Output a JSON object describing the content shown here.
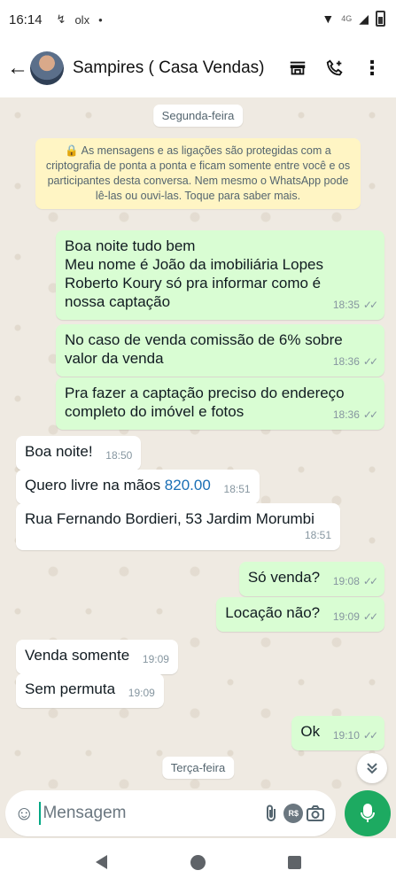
{
  "status_bar": {
    "time": "16:14",
    "network_label": "4G",
    "notification_label": "olx"
  },
  "header": {
    "back_icon": "arrow-left-icon",
    "contact_name": "Sampires ( Casa Vendas)",
    "icons": [
      "storefront-icon",
      "add-call-icon",
      "more-vert-icon"
    ]
  },
  "chat": {
    "date_monday": "Segunda-feira",
    "encryption_notice": "🔒 As mensagens e as ligações são protegidas com a criptografia de ponta a ponta e ficam somente entre você e os participantes desta conversa. Nem mesmo o WhatsApp pode lê-las ou ouvi-las. Toque para saber mais.",
    "messages": [
      {
        "direction": "out",
        "lines": [
          "Boa noite tudo bem",
          "Meu nome é João da imobiliária Lopes",
          "Roberto Koury só pra informar como é",
          "nossa captação"
        ],
        "time": "18:35",
        "ticks": "✓✓"
      },
      {
        "direction": "out",
        "lines": [
          "No caso de venda comissão de 6% sobre",
          "valor da venda"
        ],
        "time": "18:36",
        "ticks": "✓✓"
      },
      {
        "direction": "out",
        "lines": [
          "Pra fazer a captação preciso do endereço",
          "completo do imóvel e fotos"
        ],
        "time": "18:36",
        "ticks": "✓✓"
      },
      {
        "direction": "in",
        "text": "Boa noite!",
        "time": "18:50"
      },
      {
        "direction": "in",
        "text_before": "Quero livre na mãos ",
        "link_number": "820.00",
        "time": "18:51"
      },
      {
        "direction": "in",
        "text": "Rua Fernando Bordieri, 53 Jardim Morumbi",
        "time": "18:51"
      },
      {
        "direction": "out",
        "text": "Só venda?",
        "time": "19:08",
        "ticks": "✓✓"
      },
      {
        "direction": "out",
        "text": "Locação não?",
        "time": "19:09",
        "ticks": "✓✓"
      },
      {
        "direction": "in",
        "text": "Venda somente",
        "time": "19:09"
      },
      {
        "direction": "in",
        "text": "Sem permuta",
        "time": "19:09"
      },
      {
        "direction": "out",
        "text": "Ok",
        "time": "19:10",
        "ticks": "✓✓"
      }
    ],
    "date_tuesday": "Terça-feira",
    "scroll_down_icon": "double-chevron-down-icon"
  },
  "input_bar": {
    "placeholder": "Mensagem",
    "icons": [
      "emoji-icon",
      "attach-icon",
      "payment-icon",
      "camera-icon",
      "mic-icon"
    ],
    "payment_label": "R$"
  },
  "nav_bar": {
    "icons": [
      "nav-back-icon",
      "nav-home-icon",
      "nav-recents-icon"
    ]
  },
  "colors": {
    "outgoing_bubble": "#d9fdd3",
    "incoming_bubble": "#ffffff",
    "chat_background": "#efeae2",
    "encryption_notice": "#fff5c4",
    "accent_green": "#1daa61",
    "link_blue": "#1a6fb5"
  }
}
